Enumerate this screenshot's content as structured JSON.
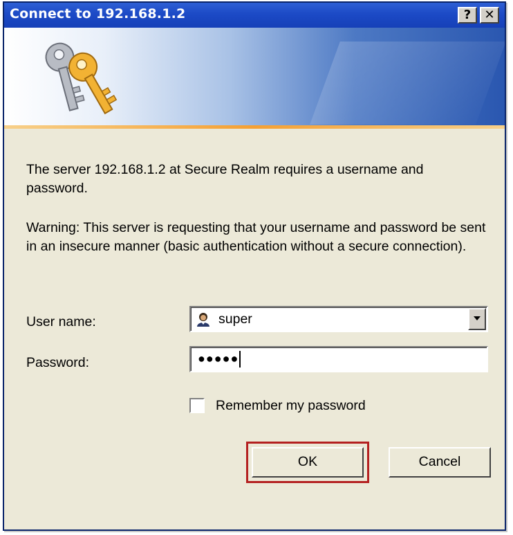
{
  "window": {
    "title": "Connect to 192.168.1.2",
    "help_label": "?",
    "close_label": "✕"
  },
  "banner": {
    "icon": "keys-icon"
  },
  "message": {
    "line1": "The server 192.168.1.2 at Secure Realm requires a username and password.",
    "warning": "Warning: This server is requesting that your username and password be sent in an insecure manner (basic authentication without a secure connection)."
  },
  "form": {
    "username_label": "User name:",
    "username_value": "super",
    "username_icon": "user-icon",
    "password_label": "Password:",
    "password_value": "●●●●●",
    "remember_label": "Remember my password",
    "remember_checked": false
  },
  "buttons": {
    "ok_label": "OK",
    "cancel_label": "Cancel"
  },
  "colors": {
    "titlebar": "#1c4ac6",
    "highlight": "#b42020",
    "dialog_bg": "#ece9d8"
  }
}
